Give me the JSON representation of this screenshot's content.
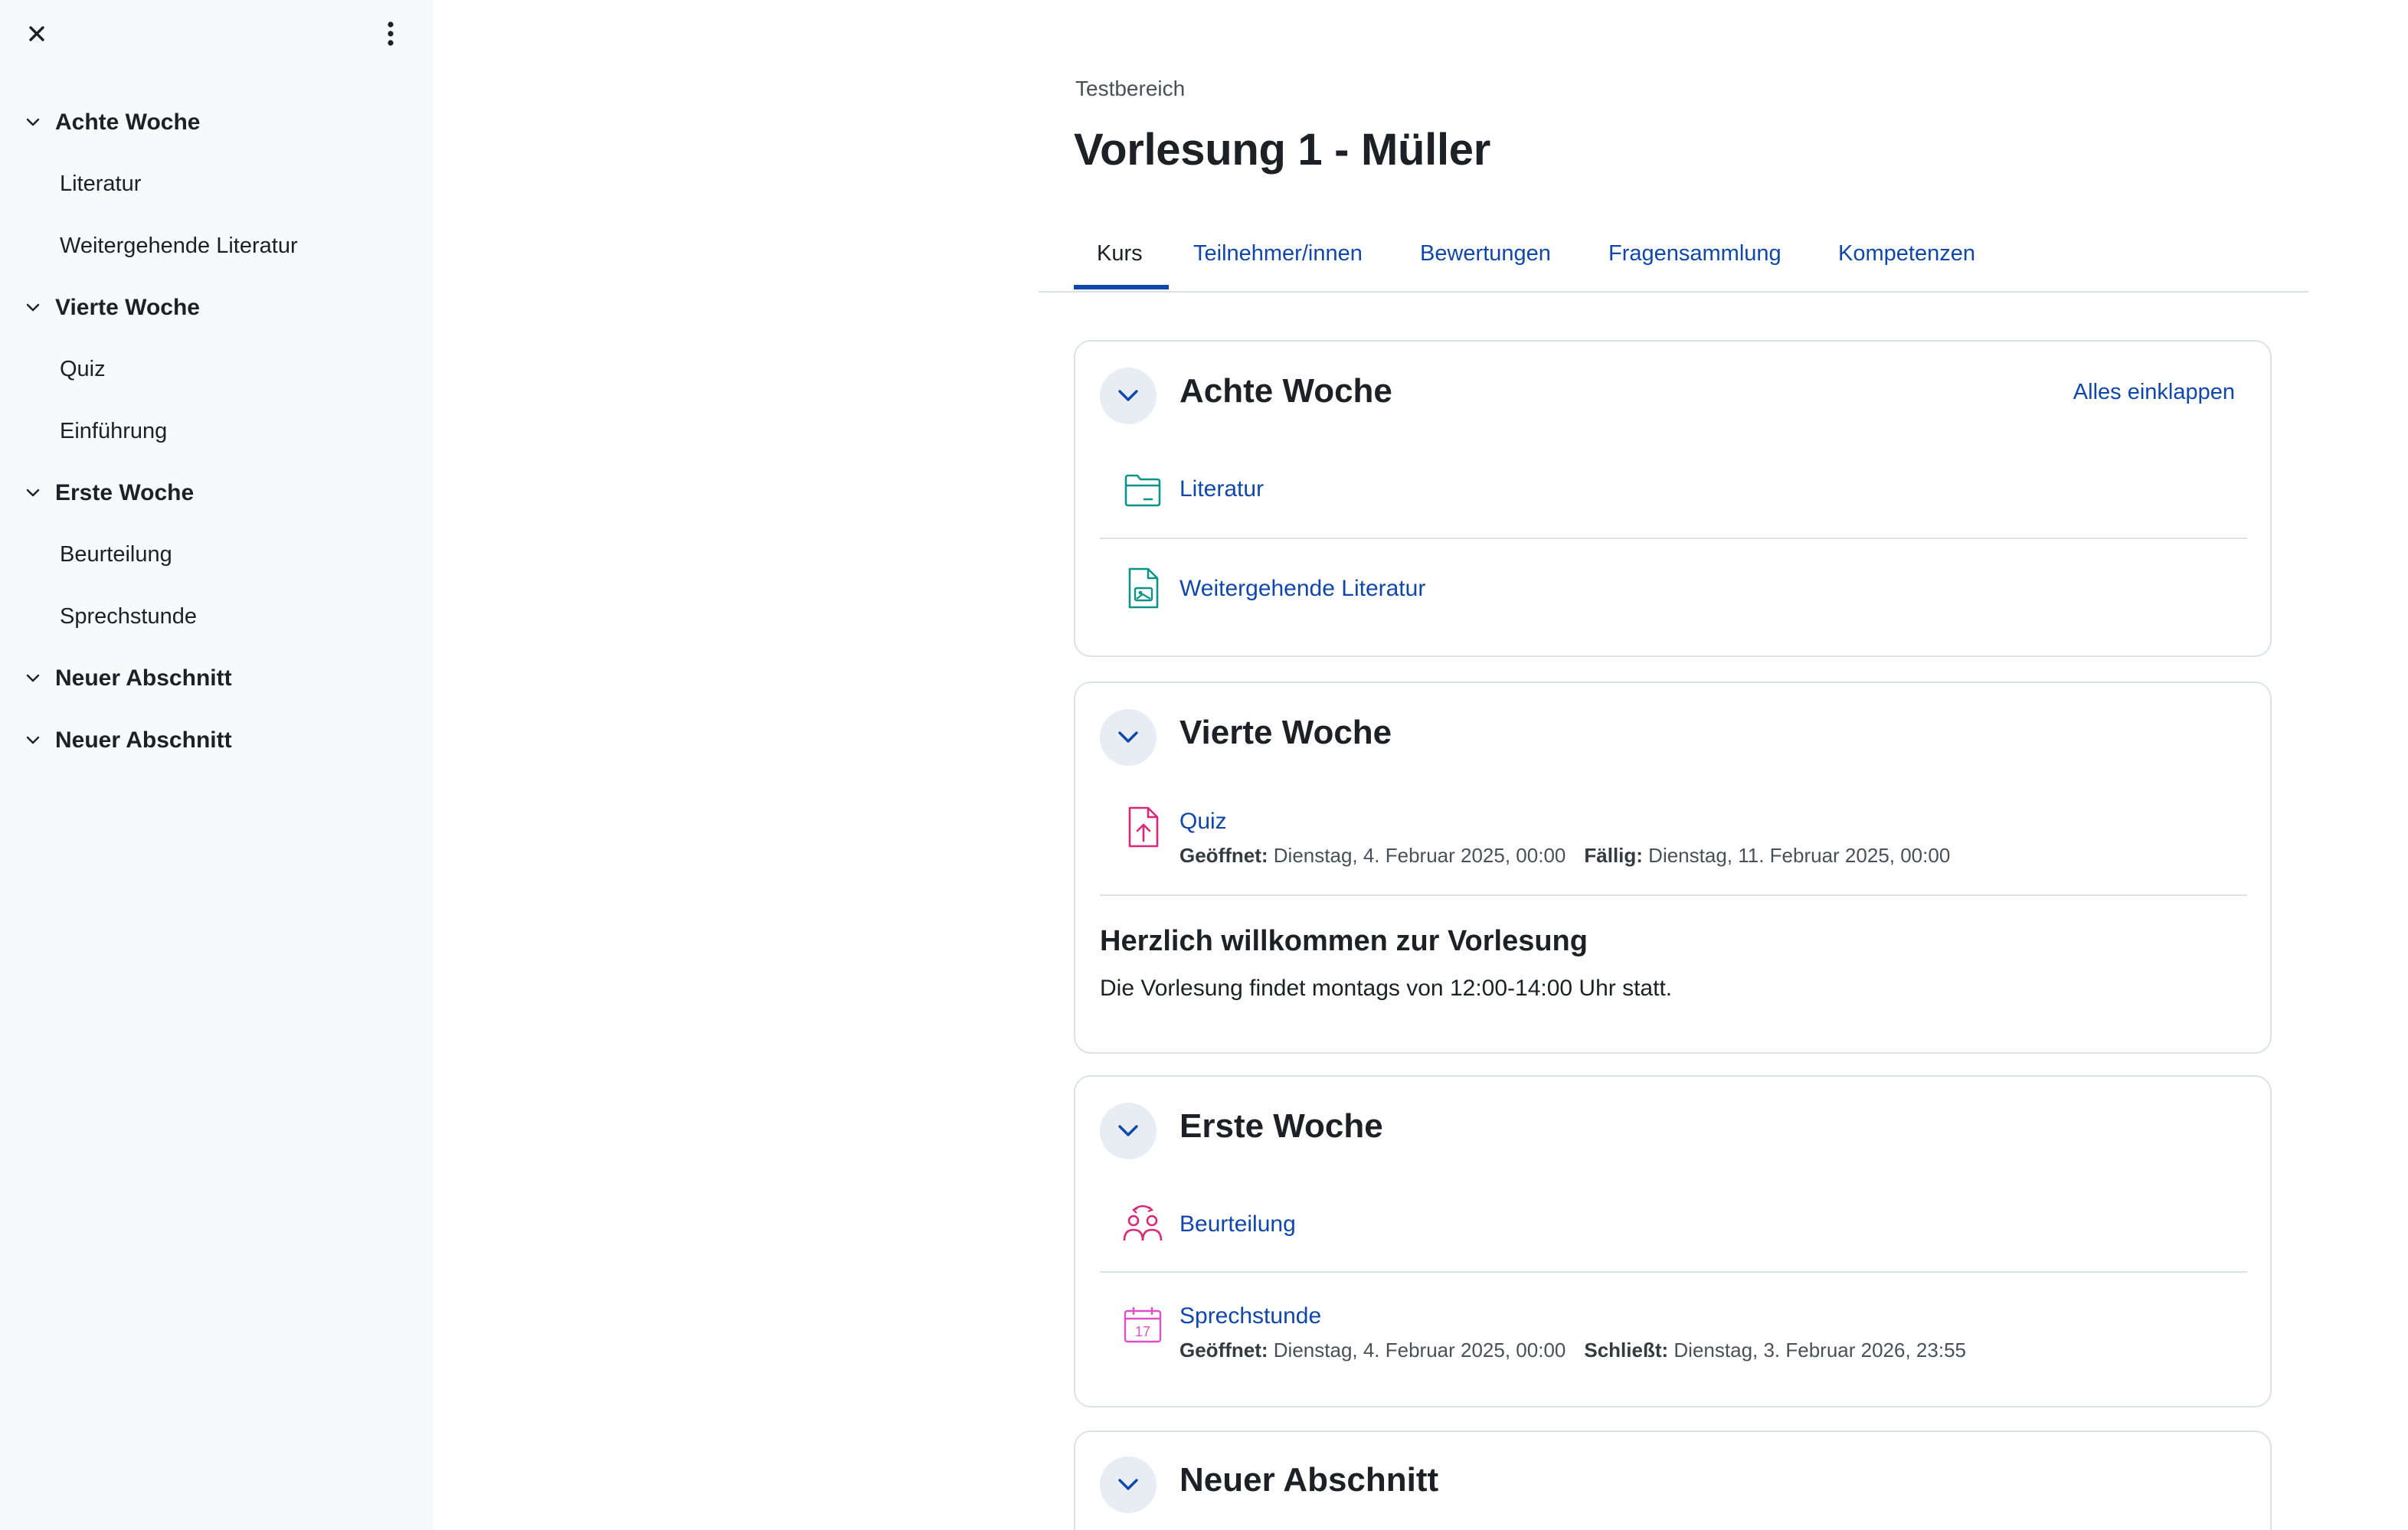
{
  "drawer": {
    "index": [
      {
        "section": "Achte Woche",
        "items": [
          "Literatur",
          "Weitergehende Literatur"
        ]
      },
      {
        "section": "Vierte Woche",
        "items": [
          "Quiz",
          "Einführung"
        ]
      },
      {
        "section": "Erste Woche",
        "items": [
          "Beurteilung",
          "Sprechstunde"
        ]
      },
      {
        "section": "Neuer Abschnitt",
        "items": []
      },
      {
        "section": "Neuer Abschnitt",
        "items": []
      }
    ]
  },
  "header": {
    "breadcrumb": "Testbereich",
    "title": "Vorlesung 1 - Müller"
  },
  "tabs": [
    "Kurs",
    "Teilnehmer/innen",
    "Bewertungen",
    "Fragensammlung",
    "Kompetenzen"
  ],
  "active_tab": "Kurs",
  "sections": [
    {
      "title": "Achte Woche",
      "collapse_all": "Alles einklappen",
      "activities": [
        {
          "name": "Literatur",
          "icon": "folder-icon"
        },
        {
          "name": "Weitergehende Literatur",
          "icon": "file-image-icon"
        }
      ]
    },
    {
      "title": "Vierte Woche",
      "activities": [
        {
          "name": "Quiz",
          "icon": "assignment-upload-icon",
          "dates": [
            {
              "label": "Geöffnet:",
              "value": "Dienstag, 4. Februar 2025, 00:00"
            },
            {
              "label": "Fällig:",
              "value": "Dienstag, 11. Februar 2025, 00:00"
            }
          ]
        }
      ],
      "summary": {
        "title": "Herzlich willkommen zur Vorlesung",
        "text": "Die Vorlesung findet montags von 12:00-14:00 Uhr statt."
      }
    },
    {
      "title": "Erste Woche",
      "activities": [
        {
          "name": "Beurteilung",
          "icon": "workshop-icon"
        },
        {
          "name": "Sprechstunde",
          "icon": "scheduler-calendar-icon",
          "calendar_day": "17",
          "dates": [
            {
              "label": "Geöffnet:",
              "value": "Dienstag, 4. Februar 2025, 00:00"
            },
            {
              "label": "Schließt:",
              "value": "Dienstag, 3. Februar 2026, 23:55"
            }
          ]
        }
      ]
    },
    {
      "title": "Neuer Abschnitt",
      "activities": []
    }
  ],
  "colors": {
    "link": "#0f47ad",
    "folder_icon": "#0d9488",
    "assessment_icon": "#db2777",
    "drawer_bg": "#f8f9fa"
  }
}
